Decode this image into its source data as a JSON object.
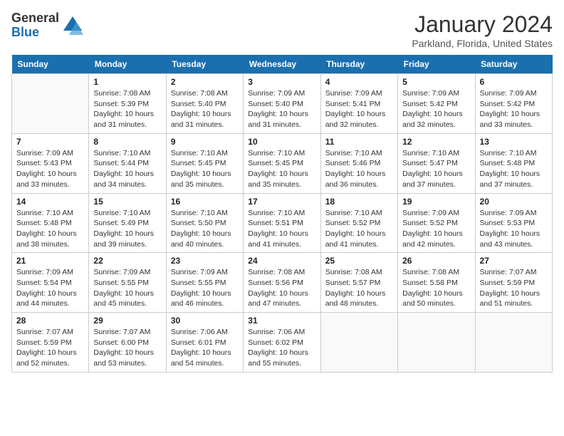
{
  "header": {
    "logo_general": "General",
    "logo_blue": "Blue",
    "title": "January 2024",
    "subtitle": "Parkland, Florida, United States"
  },
  "weekdays": [
    "Sunday",
    "Monday",
    "Tuesday",
    "Wednesday",
    "Thursday",
    "Friday",
    "Saturday"
  ],
  "weeks": [
    [
      {
        "day": "",
        "sunrise": "",
        "sunset": "",
        "daylight": ""
      },
      {
        "day": "1",
        "sunrise": "7:08 AM",
        "sunset": "5:39 PM",
        "daylight": "10 hours and 31 minutes."
      },
      {
        "day": "2",
        "sunrise": "7:08 AM",
        "sunset": "5:40 PM",
        "daylight": "10 hours and 31 minutes."
      },
      {
        "day": "3",
        "sunrise": "7:09 AM",
        "sunset": "5:40 PM",
        "daylight": "10 hours and 31 minutes."
      },
      {
        "day": "4",
        "sunrise": "7:09 AM",
        "sunset": "5:41 PM",
        "daylight": "10 hours and 32 minutes."
      },
      {
        "day": "5",
        "sunrise": "7:09 AM",
        "sunset": "5:42 PM",
        "daylight": "10 hours and 32 minutes."
      },
      {
        "day": "6",
        "sunrise": "7:09 AM",
        "sunset": "5:42 PM",
        "daylight": "10 hours and 33 minutes."
      }
    ],
    [
      {
        "day": "7",
        "sunrise": "7:09 AM",
        "sunset": "5:43 PM",
        "daylight": "10 hours and 33 minutes."
      },
      {
        "day": "8",
        "sunrise": "7:10 AM",
        "sunset": "5:44 PM",
        "daylight": "10 hours and 34 minutes."
      },
      {
        "day": "9",
        "sunrise": "7:10 AM",
        "sunset": "5:45 PM",
        "daylight": "10 hours and 35 minutes."
      },
      {
        "day": "10",
        "sunrise": "7:10 AM",
        "sunset": "5:45 PM",
        "daylight": "10 hours and 35 minutes."
      },
      {
        "day": "11",
        "sunrise": "7:10 AM",
        "sunset": "5:46 PM",
        "daylight": "10 hours and 36 minutes."
      },
      {
        "day": "12",
        "sunrise": "7:10 AM",
        "sunset": "5:47 PM",
        "daylight": "10 hours and 37 minutes."
      },
      {
        "day": "13",
        "sunrise": "7:10 AM",
        "sunset": "5:48 PM",
        "daylight": "10 hours and 37 minutes."
      }
    ],
    [
      {
        "day": "14",
        "sunrise": "7:10 AM",
        "sunset": "5:48 PM",
        "daylight": "10 hours and 38 minutes."
      },
      {
        "day": "15",
        "sunrise": "7:10 AM",
        "sunset": "5:49 PM",
        "daylight": "10 hours and 39 minutes."
      },
      {
        "day": "16",
        "sunrise": "7:10 AM",
        "sunset": "5:50 PM",
        "daylight": "10 hours and 40 minutes."
      },
      {
        "day": "17",
        "sunrise": "7:10 AM",
        "sunset": "5:51 PM",
        "daylight": "10 hours and 41 minutes."
      },
      {
        "day": "18",
        "sunrise": "7:10 AM",
        "sunset": "5:52 PM",
        "daylight": "10 hours and 41 minutes."
      },
      {
        "day": "19",
        "sunrise": "7:09 AM",
        "sunset": "5:52 PM",
        "daylight": "10 hours and 42 minutes."
      },
      {
        "day": "20",
        "sunrise": "7:09 AM",
        "sunset": "5:53 PM",
        "daylight": "10 hours and 43 minutes."
      }
    ],
    [
      {
        "day": "21",
        "sunrise": "7:09 AM",
        "sunset": "5:54 PM",
        "daylight": "10 hours and 44 minutes."
      },
      {
        "day": "22",
        "sunrise": "7:09 AM",
        "sunset": "5:55 PM",
        "daylight": "10 hours and 45 minutes."
      },
      {
        "day": "23",
        "sunrise": "7:09 AM",
        "sunset": "5:55 PM",
        "daylight": "10 hours and 46 minutes."
      },
      {
        "day": "24",
        "sunrise": "7:08 AM",
        "sunset": "5:56 PM",
        "daylight": "10 hours and 47 minutes."
      },
      {
        "day": "25",
        "sunrise": "7:08 AM",
        "sunset": "5:57 PM",
        "daylight": "10 hours and 48 minutes."
      },
      {
        "day": "26",
        "sunrise": "7:08 AM",
        "sunset": "5:58 PM",
        "daylight": "10 hours and 50 minutes."
      },
      {
        "day": "27",
        "sunrise": "7:07 AM",
        "sunset": "5:59 PM",
        "daylight": "10 hours and 51 minutes."
      }
    ],
    [
      {
        "day": "28",
        "sunrise": "7:07 AM",
        "sunset": "5:59 PM",
        "daylight": "10 hours and 52 minutes."
      },
      {
        "day": "29",
        "sunrise": "7:07 AM",
        "sunset": "6:00 PM",
        "daylight": "10 hours and 53 minutes."
      },
      {
        "day": "30",
        "sunrise": "7:06 AM",
        "sunset": "6:01 PM",
        "daylight": "10 hours and 54 minutes."
      },
      {
        "day": "31",
        "sunrise": "7:06 AM",
        "sunset": "6:02 PM",
        "daylight": "10 hours and 55 minutes."
      },
      {
        "day": "",
        "sunrise": "",
        "sunset": "",
        "daylight": ""
      },
      {
        "day": "",
        "sunrise": "",
        "sunset": "",
        "daylight": ""
      },
      {
        "day": "",
        "sunrise": "",
        "sunset": "",
        "daylight": ""
      }
    ]
  ],
  "labels": {
    "sunrise": "Sunrise:",
    "sunset": "Sunset:",
    "daylight": "Daylight:"
  }
}
